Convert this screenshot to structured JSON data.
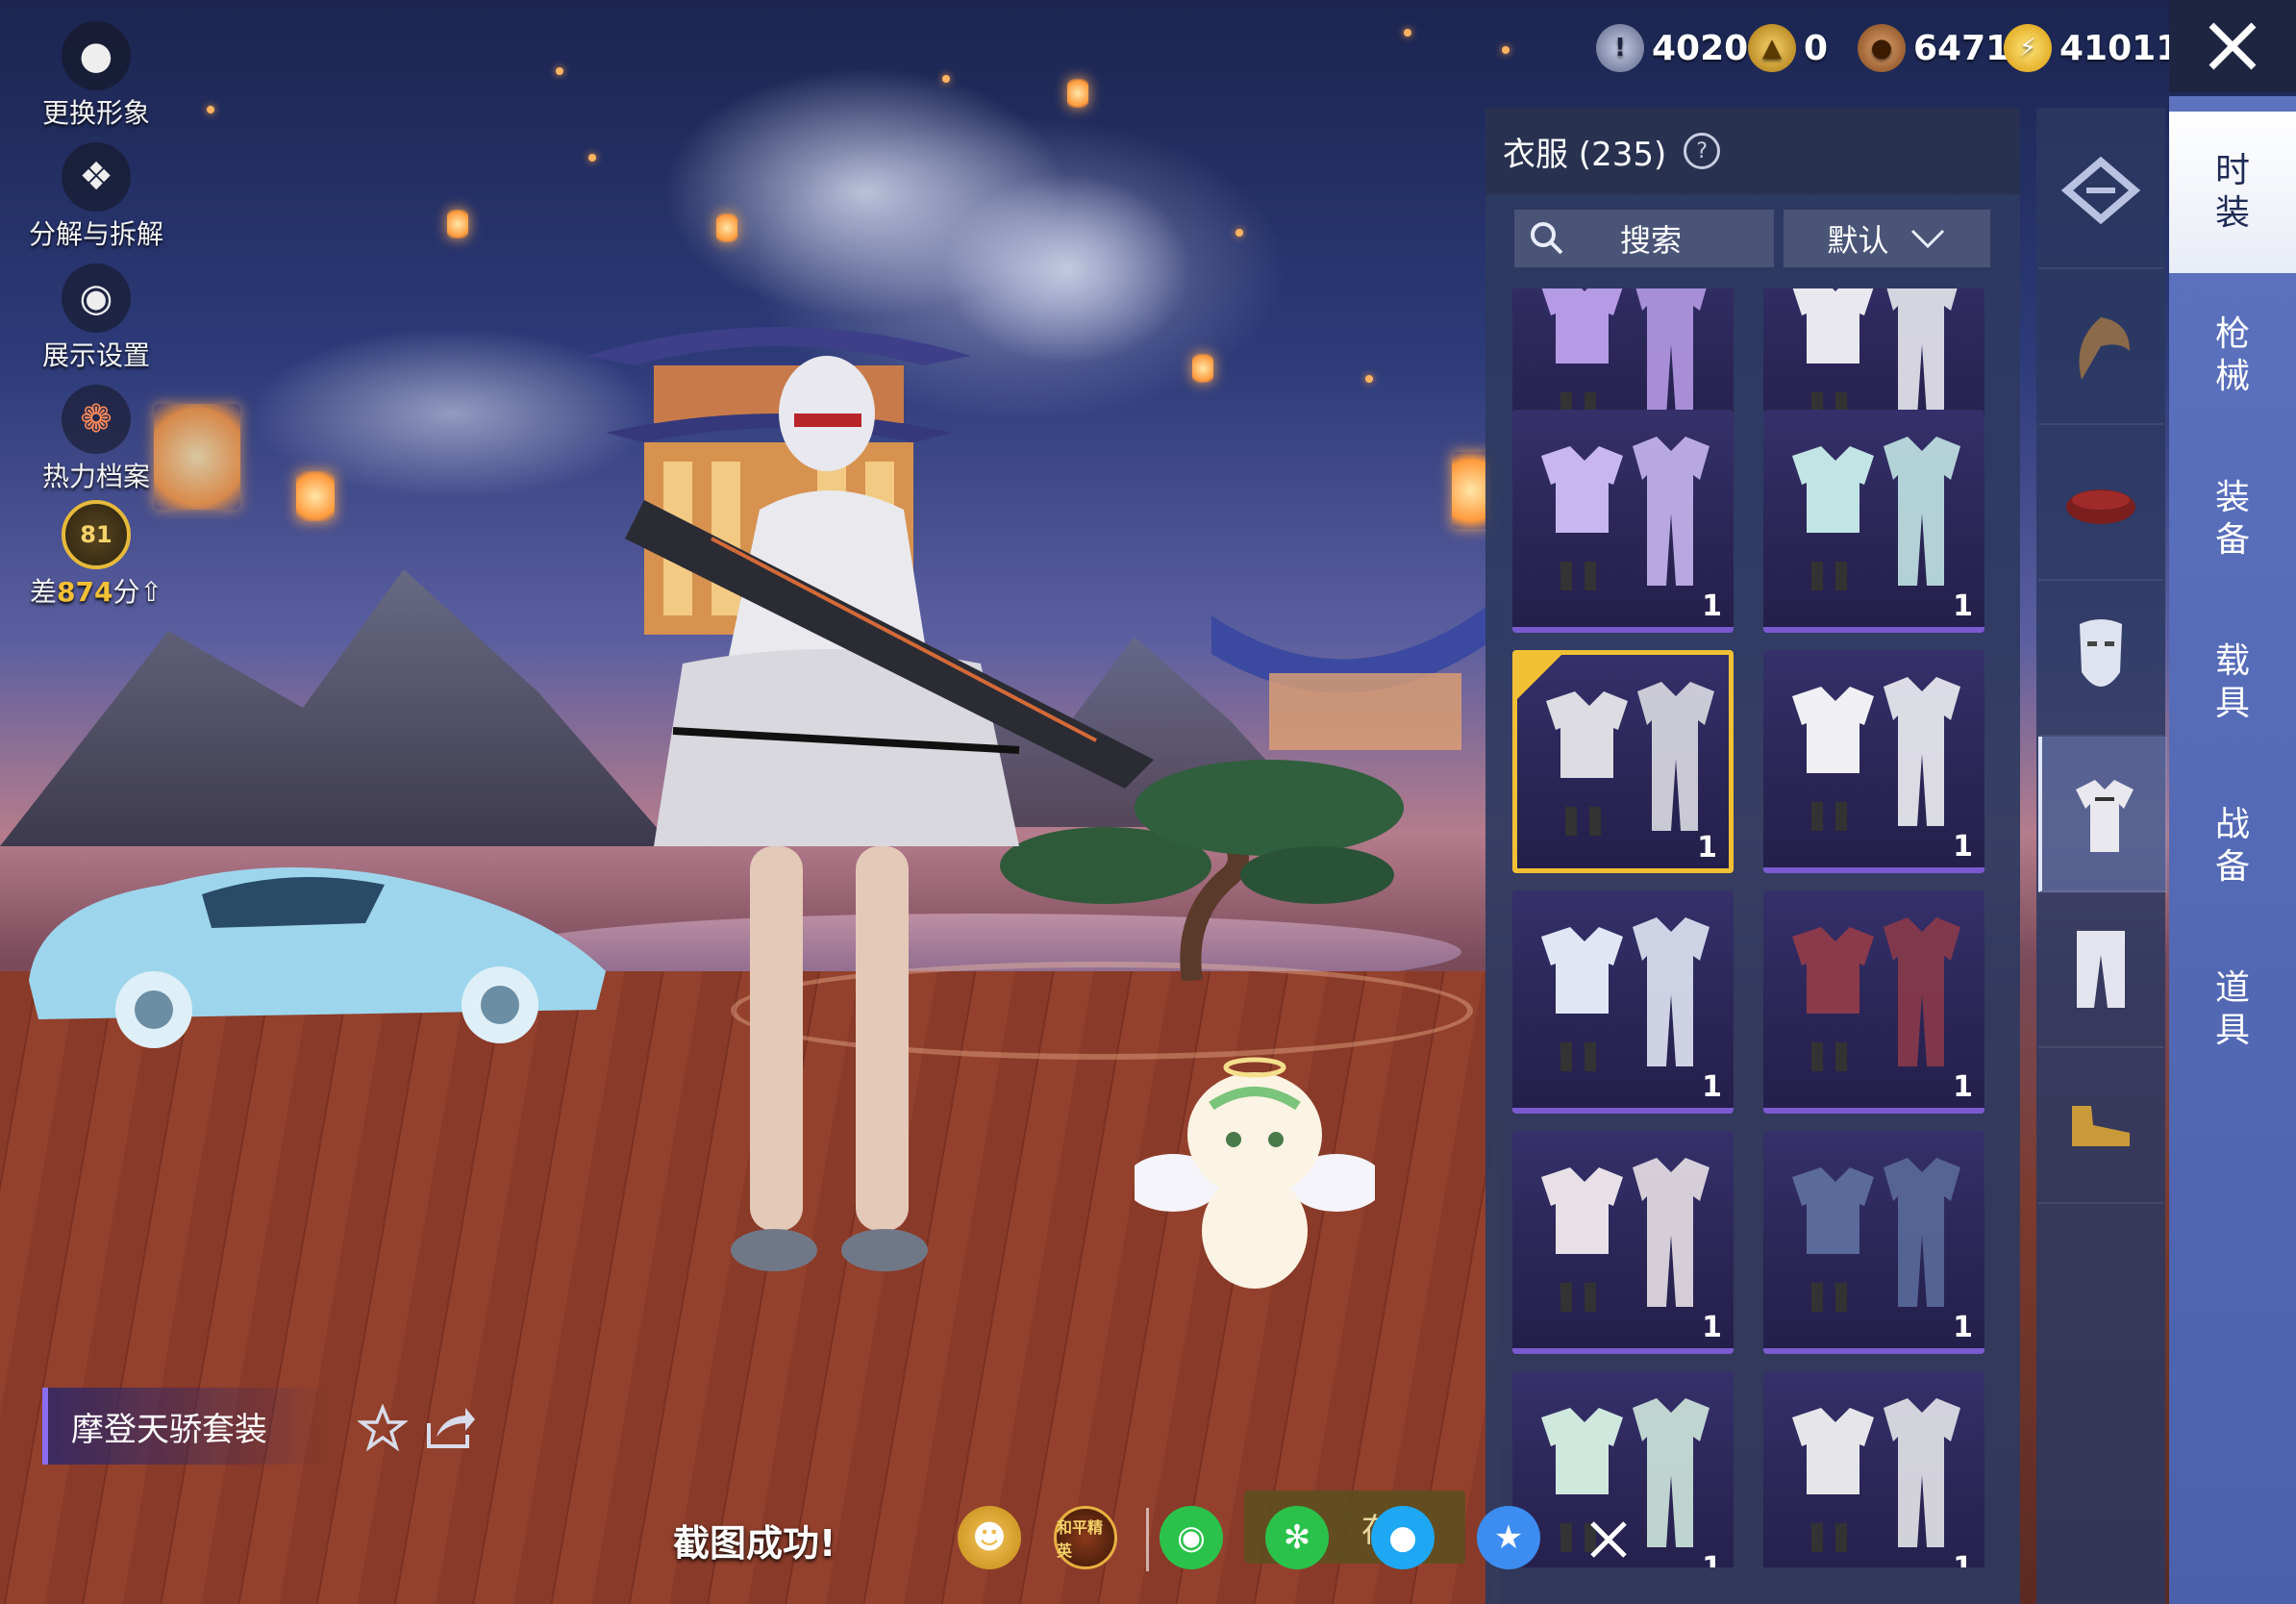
{
  "left_menu": [
    {
      "label": "更换形象",
      "icon": "person-icon"
    },
    {
      "label": "分解与拆解",
      "icon": "puzzle-icon"
    },
    {
      "label": "展示设置",
      "icon": "eye-icon"
    },
    {
      "label": "热力档案",
      "icon": "flame-icon"
    }
  ],
  "rank": {
    "level": "81",
    "prefix": "差",
    "points": "874",
    "suffix": "分"
  },
  "currencies": [
    {
      "value": "4020",
      "icon": "silver-coin-icon",
      "color": "#8a93b8"
    },
    {
      "value": "0",
      "icon": "gold-token-icon",
      "color": "#d4a21c"
    },
    {
      "value": "6471",
      "icon": "bronze-coin-icon",
      "color": "#b5743a"
    },
    {
      "value": "41011",
      "icon": "lightning-coin-icon",
      "color": "#f2c92b"
    }
  ],
  "panel": {
    "title": "衣服 (235)",
    "search_label": "搜索",
    "sort_label": "默认"
  },
  "items": [
    {
      "count": "1",
      "selected": false
    },
    {
      "count": "1",
      "selected": false
    },
    {
      "count": "1",
      "selected": false
    },
    {
      "count": "1",
      "selected": false
    },
    {
      "count": "1",
      "selected": true
    },
    {
      "count": "1",
      "selected": false
    },
    {
      "count": "1",
      "selected": false
    },
    {
      "count": "1",
      "selected": false
    },
    {
      "count": "1",
      "selected": false
    },
    {
      "count": "1",
      "selected": false
    },
    {
      "count": "1",
      "selected": false
    },
    {
      "count": "1",
      "selected": false
    }
  ],
  "categories": [
    {
      "icon": "all-items-icon"
    },
    {
      "icon": "hair-icon"
    },
    {
      "icon": "hat-icon"
    },
    {
      "icon": "mask-icon"
    },
    {
      "icon": "outfit-icon",
      "active": true
    },
    {
      "icon": "pants-icon"
    },
    {
      "icon": "shoes-icon"
    }
  ],
  "tabs": [
    {
      "line1": "时",
      "line2": "装",
      "active": true
    },
    {
      "line1": "枪",
      "line2": "械"
    },
    {
      "line1": "装",
      "line2": "备"
    },
    {
      "line1": "载",
      "line2": "具"
    },
    {
      "line1": "战",
      "line2": "备"
    },
    {
      "line1": "道",
      "line2": "具"
    }
  ],
  "suit_name": "摩登天骄套装",
  "screenshot_toast": "截图成功!",
  "share_partial_label": "存挡",
  "share_logo_text": "和平精英",
  "colors": {
    "accent_gold": "#f2c035",
    "tab_blue": "#5d73c0",
    "card_border": "#7a5ad0"
  }
}
